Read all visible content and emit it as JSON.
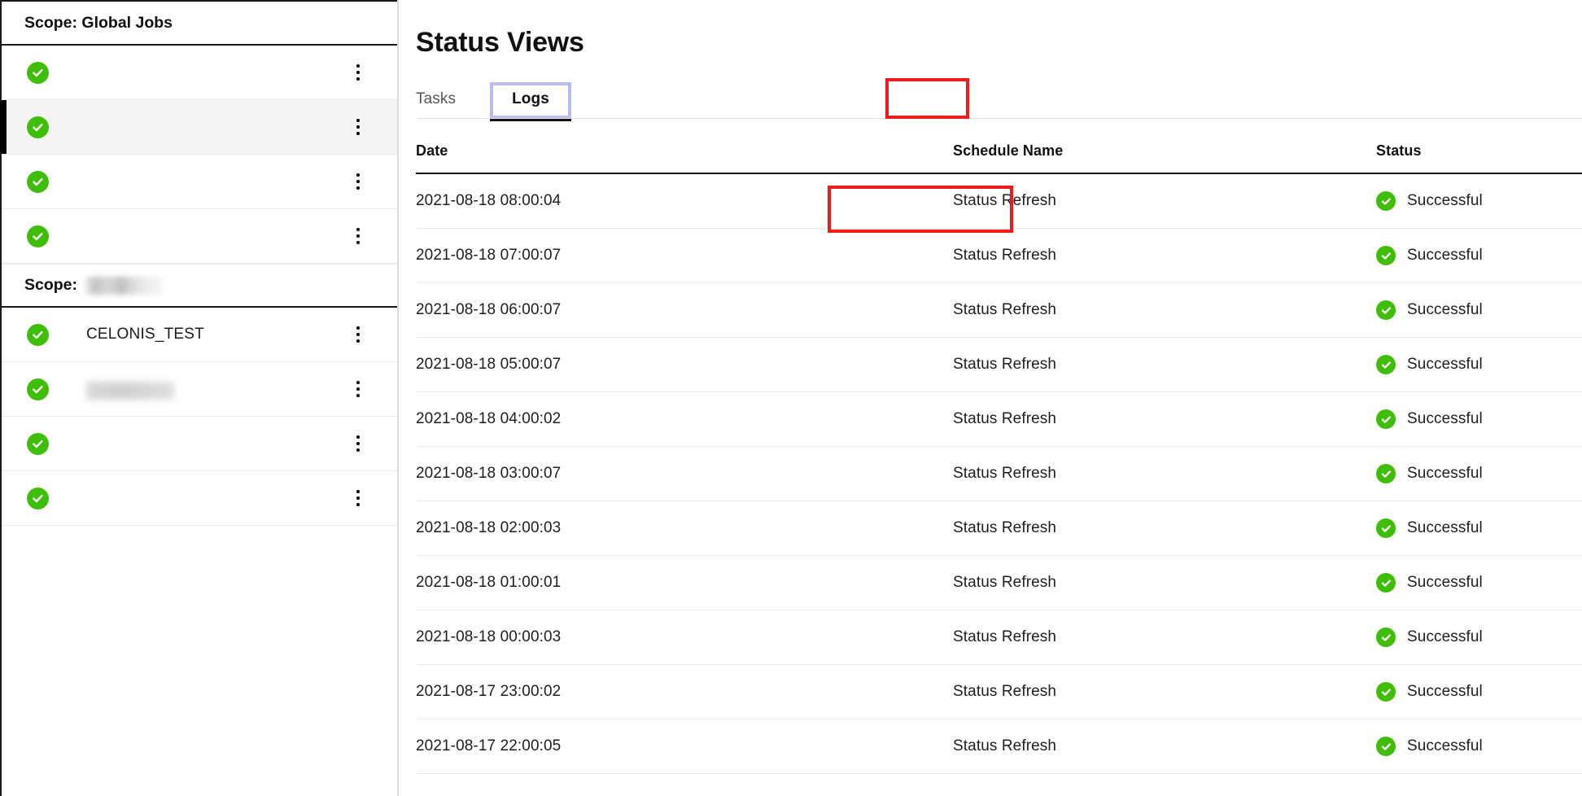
{
  "sidebar": {
    "groups": [
      {
        "scope_label": "Scope: Global Jobs",
        "scope_value": "",
        "scope_value_redacted": false,
        "items": [
          {
            "name": "",
            "redacted": true,
            "redaction_style": "bb-a",
            "status_icon": "check-circle-icon",
            "selected": false
          },
          {
            "name": "",
            "redacted": true,
            "redaction_style": "bb-b",
            "status_icon": "check-circle-icon",
            "selected": true
          },
          {
            "name": "",
            "redacted": true,
            "redaction_style": "bb-c",
            "status_icon": "check-circle-icon",
            "selected": false
          },
          {
            "name": "",
            "redacted": true,
            "redaction_style": "bb-d",
            "status_icon": "check-circle-icon",
            "selected": false
          }
        ]
      },
      {
        "scope_label": "Scope:",
        "scope_value": "",
        "scope_value_redacted": true,
        "items": [
          {
            "name": "CELONIS_TEST",
            "redacted": false,
            "redaction_style": "",
            "status_icon": "check-circle-icon",
            "selected": false
          },
          {
            "name": "",
            "redacted": true,
            "redaction_style": "bb-e",
            "status_icon": "check-circle-icon",
            "selected": false
          },
          {
            "name": "",
            "redacted": true,
            "redaction_style": "bb-g",
            "status_icon": "check-circle-icon",
            "selected": false
          },
          {
            "name": "",
            "redacted": true,
            "redaction_style": "bb-h",
            "status_icon": "check-circle-icon",
            "selected": false
          }
        ]
      }
    ],
    "row_menu_icon": "kebab-menu-icon"
  },
  "main": {
    "title": "Status Views",
    "tabs": [
      {
        "label": "Tasks",
        "active": false
      },
      {
        "label": "Logs",
        "active": true
      }
    ],
    "table": {
      "columns": [
        "Date",
        "Schedule Name",
        "Status"
      ],
      "rows": [
        {
          "date": "2021-08-18 08:00:04",
          "schedule_name": "Status Refresh",
          "status": "Successful",
          "status_icon": "check-circle-icon",
          "highlighted": true
        },
        {
          "date": "2021-08-18 07:00:07",
          "schedule_name": "Status Refresh",
          "status": "Successful",
          "status_icon": "check-circle-icon",
          "highlighted": false
        },
        {
          "date": "2021-08-18 06:00:07",
          "schedule_name": "Status Refresh",
          "status": "Successful",
          "status_icon": "check-circle-icon",
          "highlighted": false
        },
        {
          "date": "2021-08-18 05:00:07",
          "schedule_name": "Status Refresh",
          "status": "Successful",
          "status_icon": "check-circle-icon",
          "highlighted": false
        },
        {
          "date": "2021-08-18 04:00:02",
          "schedule_name": "Status Refresh",
          "status": "Successful",
          "status_icon": "check-circle-icon",
          "highlighted": false
        },
        {
          "date": "2021-08-18 03:00:07",
          "schedule_name": "Status Refresh",
          "status": "Successful",
          "status_icon": "check-circle-icon",
          "highlighted": false
        },
        {
          "date": "2021-08-18 02:00:03",
          "schedule_name": "Status Refresh",
          "status": "Successful",
          "status_icon": "check-circle-icon",
          "highlighted": false
        },
        {
          "date": "2021-08-18 01:00:01",
          "schedule_name": "Status Refresh",
          "status": "Successful",
          "status_icon": "check-circle-icon",
          "highlighted": false
        },
        {
          "date": "2021-08-18 00:00:03",
          "schedule_name": "Status Refresh",
          "status": "Successful",
          "status_icon": "check-circle-icon",
          "highlighted": false
        },
        {
          "date": "2021-08-17 23:00:02",
          "schedule_name": "Status Refresh",
          "status": "Successful",
          "status_icon": "check-circle-icon",
          "highlighted": false
        },
        {
          "date": "2021-08-17 22:00:05",
          "schedule_name": "Status Refresh",
          "status": "Successful",
          "status_icon": "check-circle-icon",
          "highlighted": false
        }
      ]
    }
  },
  "annotations": [
    {
      "name": "logs-tab-highlight",
      "color": "#f01c1c",
      "target": "Logs"
    },
    {
      "name": "first-date-cell-highlight",
      "color": "#f01c1c",
      "target": "2021-08-18 08:00:04"
    }
  ],
  "colors": {
    "success_green": "#3fbe07",
    "annotation_red": "#f01c1c",
    "focus_ring": "#b9bdf0",
    "selected_row_bg": "#f4f4f4",
    "active_tab_underline": "#141414"
  }
}
